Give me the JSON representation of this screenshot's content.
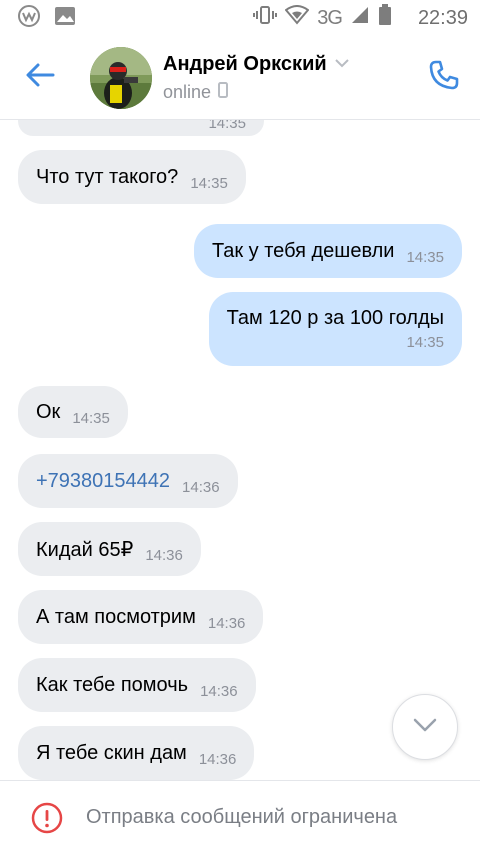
{
  "status_bar": {
    "network": "3G",
    "time": "22:39"
  },
  "header": {
    "contact_name": "Андрей Оркский",
    "status": "online"
  },
  "messages": [
    {
      "direction": "in",
      "text": "Что тут такого?",
      "time": "14:35"
    },
    {
      "direction": "out",
      "text": "Так у тебя дешевли",
      "time": "14:35"
    },
    {
      "direction": "out",
      "text": "Там 120 р за 100 голды",
      "time": "14:35"
    },
    {
      "direction": "in",
      "text": "Ок",
      "time": "14:35"
    },
    {
      "direction": "in",
      "text": "+79380154442",
      "time": "14:36",
      "is_link": true
    },
    {
      "direction": "in",
      "text": "Кидай 65₽",
      "time": "14:36"
    },
    {
      "direction": "in",
      "text": "А там посмотрим",
      "time": "14:36"
    },
    {
      "direction": "in",
      "text": "Как тебе помочь",
      "time": "14:36"
    },
    {
      "direction": "in",
      "text": "Я тебе скин дам",
      "time": "14:36"
    }
  ],
  "clipped_message": {
    "time": "14:35"
  },
  "footer": {
    "restricted_text": "Отправка сообщений ограничена"
  },
  "colors": {
    "accent": "#3f8ae0",
    "incoming_bubble": "#ebedf0",
    "outgoing_bubble": "#cce4ff",
    "error": "#e64646"
  }
}
